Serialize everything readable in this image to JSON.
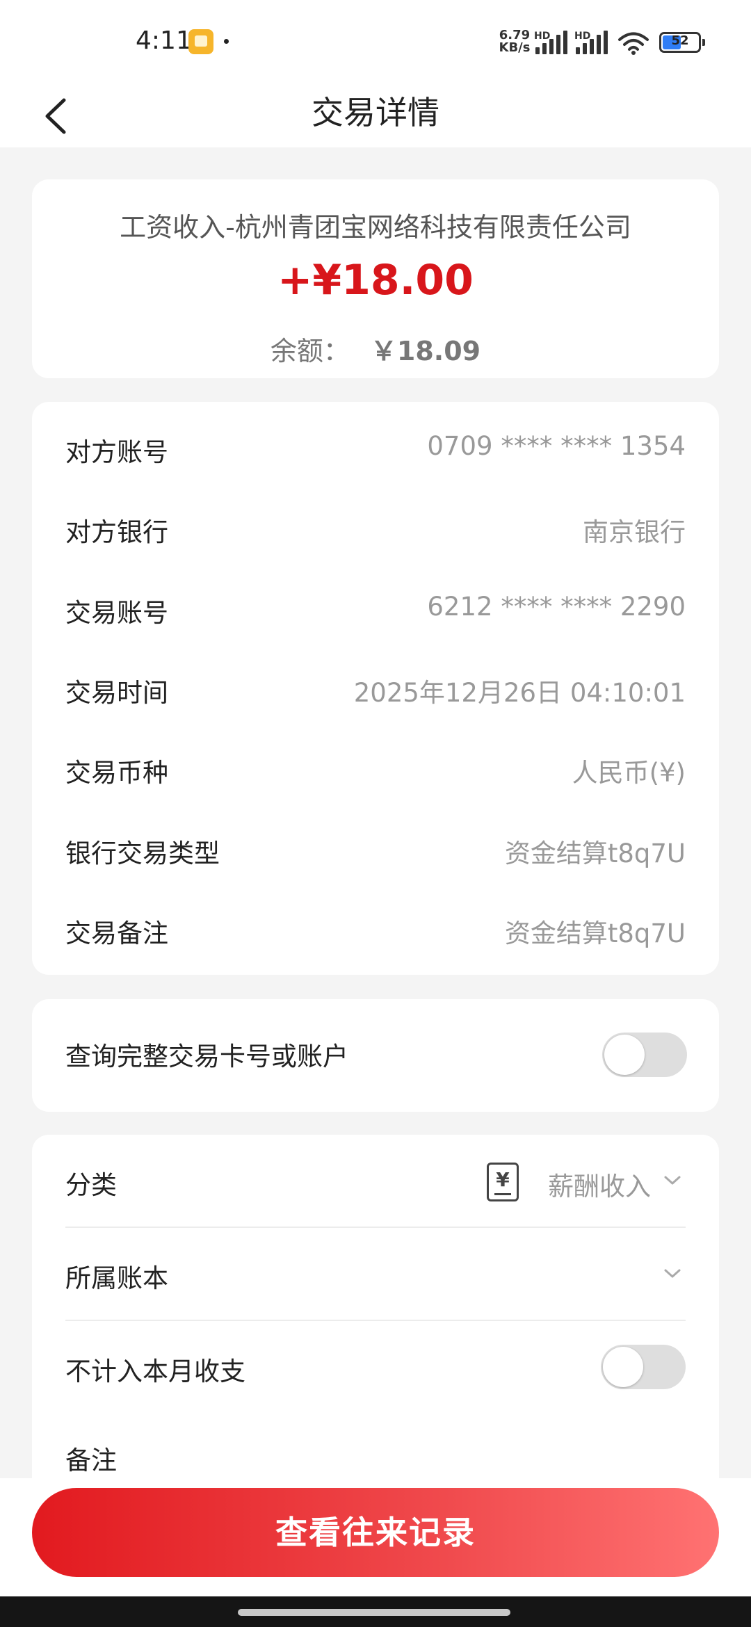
{
  "status_bar": {
    "time": "4:11",
    "net_speed_value": "6.79",
    "net_speed_unit": "KB/s",
    "signal_label_1": "HD",
    "signal_label_2": "HD",
    "battery": "52"
  },
  "nav": {
    "title": "交易详情",
    "back_icon": "chevron-left-icon"
  },
  "summary": {
    "name": "工资收入-杭州青团宝网络科技有限责任公司",
    "amount": "+¥18.00",
    "amount_color": "#d8161b",
    "balance_label": "余额：",
    "balance_value": "￥18.09"
  },
  "details": [
    {
      "label": "对方账号",
      "value": "0709 **** **** 1354"
    },
    {
      "label": "对方银行",
      "value": "南京银行"
    },
    {
      "label": "交易账号",
      "value": "6212 **** **** 2290"
    },
    {
      "label": "交易时间",
      "value": "2025年12月26日 04:10:01"
    },
    {
      "label": "交易币种",
      "value": "人民币(¥)"
    },
    {
      "label": "银行交易类型",
      "value": "资金结算t8q7U"
    },
    {
      "label": "交易备注",
      "value": "资金结算t8q7U"
    }
  ],
  "full_card_toggle": {
    "label": "查询完整交易卡号或账户",
    "on": false
  },
  "category": {
    "category_label": "分类",
    "category_icon_glyph": "¥",
    "category_value": "薪酬收入",
    "ledger_label": "所属账本",
    "exclude_label": "不计入本月收支",
    "exclude_on": false,
    "note_label": "备注"
  },
  "bottom": {
    "button_label": "查看往来记录",
    "button_color": "#e21a1f"
  }
}
